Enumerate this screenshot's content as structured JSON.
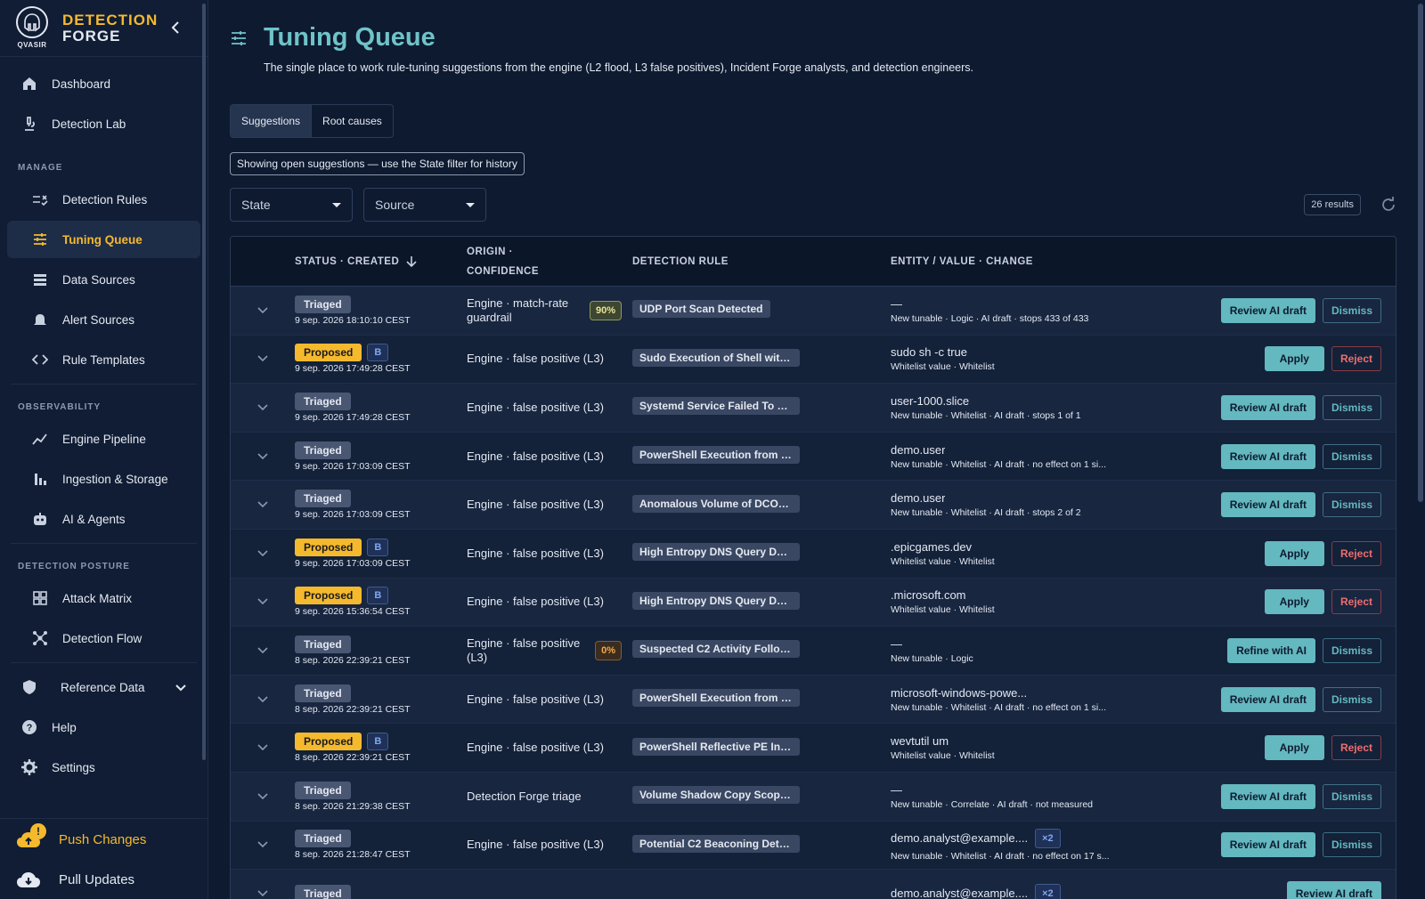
{
  "brand": {
    "line1": "DETECTION",
    "line2": "FORGE",
    "logo_sub": "QVASIR"
  },
  "sidebar": {
    "top_items": [
      {
        "label": "Dashboard",
        "icon": "home-icon"
      },
      {
        "label": "Detection Lab",
        "icon": "microscope-icon"
      }
    ],
    "sections": {
      "manage": "MANAGE",
      "observability": "OBSERVABILITY",
      "posture": "DETECTION POSTURE"
    },
    "manage_items": [
      {
        "label": "Detection Rules"
      },
      {
        "label": "Tuning Queue"
      },
      {
        "label": "Data Sources"
      },
      {
        "label": "Alert Sources"
      },
      {
        "label": "Rule Templates"
      }
    ],
    "observability_items": [
      {
        "label": "Engine Pipeline"
      },
      {
        "label": "Ingestion & Storage"
      },
      {
        "label": "AI & Agents"
      }
    ],
    "posture_items": [
      {
        "label": "Attack Matrix"
      },
      {
        "label": "Detection Flow"
      }
    ],
    "reference_data": "Reference Data",
    "help": "Help",
    "settings": "Settings",
    "push_changes": "Push Changes",
    "push_badge": "!",
    "pull_updates": "Pull Updates"
  },
  "page": {
    "title": "Tuning Queue",
    "subtitle": "The single place to work rule-tuning suggestions from the engine (L2 flood, L3 false positives), Incident Forge analysts, and detection engineers.",
    "tabs": [
      "Suggestions",
      "Root causes"
    ],
    "info_chip": "Showing open suggestions — use the State filter for history",
    "filter_state": "State",
    "filter_source": "Source",
    "results": "26 results"
  },
  "table": {
    "headers": {
      "status": "STATUS · CREATED",
      "origin_l1": "ORIGIN ·",
      "origin_l2": "CONFIDENCE",
      "rule": "DETECTION RULE",
      "entity": "ENTITY / VALUE · CHANGE"
    },
    "rows": [
      {
        "status": "Triaged",
        "b": "",
        "created": "9 sep. 2026 18:10:10 CEST",
        "origin": "Engine · match-rate guardrail",
        "confidence": "90%",
        "rule": "UDP Port Scan Detected",
        "entity": "—",
        "x": "",
        "change": "New tunable · Logic · AI draft · stops 433 of 433",
        "action1": "Review AI draft",
        "action2": "Dismiss"
      },
      {
        "status": "Proposed",
        "b": "B",
        "created": "9 sep. 2026 17:49:28 CEST",
        "origin": "Engine · false positive (L3)",
        "confidence": "",
        "rule": "Sudo Execution of Shell with C...",
        "entity": "sudo sh -c true",
        "x": "",
        "change": "Whitelist value · Whitelist",
        "action1": "Apply",
        "action2": "Reject"
      },
      {
        "status": "Triaged",
        "b": "",
        "created": "9 sep. 2026 17:49:28 CEST",
        "origin": "Engine · false positive (L3)",
        "confidence": "",
        "rule": "Systemd Service Failed To Start",
        "entity": "user-1000.slice",
        "x": "",
        "change": "New tunable · Whitelist · AI draft · stops 1 of 1",
        "action1": "Review AI draft",
        "action2": "Dismiss"
      },
      {
        "status": "Triaged",
        "b": "",
        "created": "9 sep. 2026 17:03:09 CEST",
        "origin": "Engine · false positive (L3)",
        "confidence": "",
        "rule": "PowerShell Execution from an ...",
        "entity": "demo.user",
        "x": "",
        "change": "New tunable · Whitelist · AI draft · no effect on 1 si...",
        "action1": "Review AI draft",
        "action2": "Dismiss"
      },
      {
        "status": "Triaged",
        "b": "",
        "created": "9 sep. 2026 17:03:09 CEST",
        "origin": "Engine · false positive (L3)",
        "confidence": "",
        "rule": "Anomalous Volume of DCOM ...",
        "entity": "demo.user",
        "x": "",
        "change": "New tunable · Whitelist · AI draft · stops 2 of 2",
        "action1": "Review AI draft",
        "action2": "Dismiss"
      },
      {
        "status": "Proposed",
        "b": "B",
        "created": "9 sep. 2026 17:03:09 CEST",
        "origin": "Engine · false positive (L3)",
        "confidence": "",
        "rule": "High Entropy DNS Query Detec...",
        "entity": ".epicgames.dev",
        "x": "",
        "change": "Whitelist value · Whitelist",
        "action1": "Apply",
        "action2": "Reject"
      },
      {
        "status": "Proposed",
        "b": "B",
        "created": "9 sep. 2026 15:36:54 CEST",
        "origin": "Engine · false positive (L3)",
        "confidence": "",
        "rule": "High Entropy DNS Query Detec...",
        "entity": ".microsoft.com",
        "x": "",
        "change": "Whitelist value · Whitelist",
        "action1": "Apply",
        "action2": "Reject"
      },
      {
        "status": "Triaged",
        "b": "",
        "created": "8 sep. 2026 22:39:21 CEST",
        "origin": "Engine · false positive (L3)",
        "confidence": "0%",
        "rule": "Suspected C2 Activity Followin...",
        "entity": "—",
        "x": "",
        "change": "New tunable · Logic",
        "action1": "Refine with AI",
        "action2": "Dismiss"
      },
      {
        "status": "Triaged",
        "b": "",
        "created": "8 sep. 2026 22:39:21 CEST",
        "origin": "Engine · false positive (L3)",
        "confidence": "",
        "rule": "PowerShell Execution from an ...",
        "entity": "microsoft-windows-powe...",
        "x": "",
        "change": "New tunable · Whitelist · AI draft · no effect on 1 si...",
        "action1": "Review AI draft",
        "action2": "Dismiss"
      },
      {
        "status": "Proposed",
        "b": "B",
        "created": "8 sep. 2026 22:39:21 CEST",
        "origin": "Engine · false positive (L3)",
        "confidence": "",
        "rule": "PowerShell Reflective PE Injec...",
        "entity": "wevtutil um",
        "x": "",
        "change": "Whitelist value · Whitelist",
        "action1": "Apply",
        "action2": "Reject"
      },
      {
        "status": "Triaged",
        "b": "",
        "created": "8 sep. 2026 21:29:38 CEST",
        "origin": "Detection Forge triage",
        "confidence": "",
        "rule": "Volume Shadow Copy Scoping...",
        "entity": "—",
        "x": "",
        "change": "New tunable · Correlate · AI draft · not measured",
        "action1": "Review AI draft",
        "action2": "Dismiss"
      },
      {
        "status": "Triaged",
        "b": "",
        "created": "8 sep. 2026 21:28:47 CEST",
        "origin": "Engine · false positive (L3)",
        "confidence": "",
        "rule": "Potential C2 Beaconing Detect...",
        "entity": "demo.analyst@example....",
        "x": "×2",
        "change": "New tunable · Whitelist · AI draft · no effect on 17 s...",
        "action1": "Review AI draft",
        "action2": "Dismiss"
      },
      {
        "status": "Triaged",
        "b": "",
        "created": "",
        "origin": "",
        "confidence": "",
        "rule": "",
        "entity": "demo.analyst@example....",
        "x": "×2",
        "change": "",
        "action1": "Review AI draft",
        "action2": ""
      }
    ]
  },
  "colors": {
    "accent": "#6fc3c8",
    "brand": "#f5b92e",
    "reject": "#ef6d6d",
    "bg": "#0e1a30"
  }
}
